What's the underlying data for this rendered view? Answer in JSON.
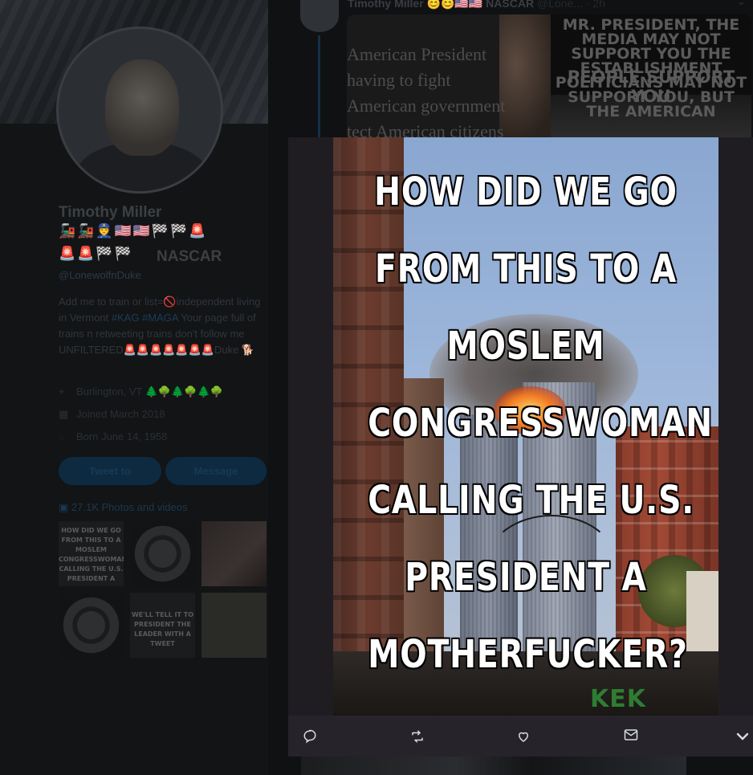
{
  "profile": {
    "name": "Timothy Miller",
    "name_emoji_line1": "🚂🚂👮🇺🇸🇺🇸🏁🏁🚨",
    "name_emoji_line2": "🚨🚨🏁🏁",
    "name_suffix": "NASCAR",
    "handle": "@LonewolfnDuke",
    "bio_part1": "Add me to train or list=🚫independent living in Vermont ",
    "bio_tag1": "#KAG",
    "bio_tag2": "#MAGA",
    "bio_part2": " Your page full of trains n retweeting trains don't follow me UNFILTERED🚨🚨🚨🚨🚨🚨🚨Duke 🐕",
    "location": "Burlington, VT 🌲🌳🌲🌳🌲🌳",
    "joined": "Joined March 2018",
    "born": "Born June 14, 1958",
    "tweet_to_label": "Tweet to",
    "message_label": "Message",
    "photos_label": "27.1K Photos and videos",
    "thumb1_text": "HOW DID WE GO FROM THIS TO A MOSLEM CONGRESSWOMAN CALLING THE U.S. PRESIDENT A",
    "thumb5_text": "WE'LL TELL IT TO PRESIDENT THE LEADER WITH A TWEET"
  },
  "tweet": {
    "author": "Timothy Miller",
    "author_emoji": "😊😊🇺🇸🇺🇸",
    "author_suffix": "NASCAR",
    "handle_time": "@Lone... · 2h",
    "left_meme_text": "American President having to fight American government tect American citizens",
    "right_meme_line1": "MR. PRESIDENT, THE MEDIA MAY NOT SUPPORT YOU THE ESTABLISHMENT POLITICIANS MAY NOT SUPPORT YOU, BUT THE AMERICAN",
    "right_meme_line2": "PEOPLE SUPPORT YOU"
  },
  "modal": {
    "caption_lines": [
      "HOW DID WE GO",
      "FROM THIS TO A",
      "MOSLEM",
      "CONGRESSWOMAN",
      "CALLING THE U.S.",
      "PRESIDENT A",
      "MOTHERFUCKER?"
    ],
    "watermark": "KEK",
    "actions": {
      "reply_icon": "reply-icon",
      "retweet_icon": "retweet-icon",
      "like_icon": "heart-icon",
      "dm_icon": "envelope-icon",
      "more_icon": "chevron-down-icon"
    }
  },
  "colors": {
    "modal_bg": "#201d22",
    "action_icon": "#d8dde2",
    "caption": "#ffffff"
  }
}
